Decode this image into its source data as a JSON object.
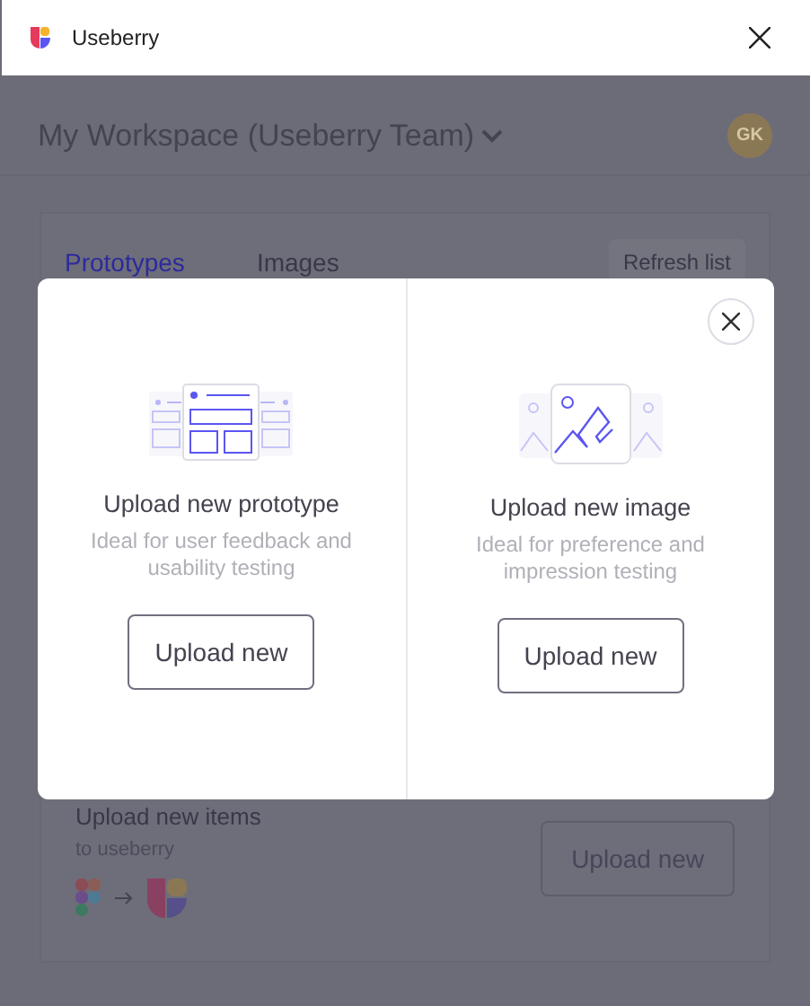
{
  "window": {
    "title": "Useberry"
  },
  "workspace": {
    "name": "My Workspace (Useberry Team)",
    "avatar": "GK"
  },
  "tabs": [
    {
      "label": "Prototypes",
      "selected": true
    },
    {
      "label": "Images",
      "selected": false
    }
  ],
  "refresh_button": "Refresh list",
  "upload_section": {
    "title": "Upload new items",
    "subtitle": "to useberry",
    "button": "Upload new"
  },
  "modal": {
    "options": [
      {
        "kind": "prototype",
        "title": "Upload new prototype",
        "description": "Ideal for user feedback and usability testing",
        "button": "Upload new"
      },
      {
        "kind": "image",
        "title": "Upload new image",
        "description": "Ideal for preference and impression testing",
        "button": "Upload new"
      }
    ]
  }
}
